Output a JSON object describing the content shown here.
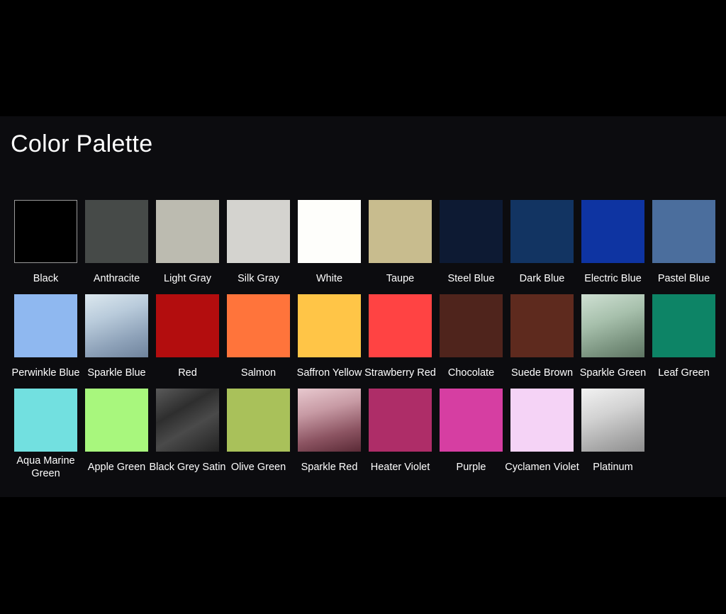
{
  "title": "Color Palette",
  "swatches": [
    {
      "label": "Black",
      "color": "#000000",
      "bg": "#000000",
      "border": "#9a9a9a"
    },
    {
      "label": "Anthracite",
      "color": "#464a48",
      "bg": "#464a48"
    },
    {
      "label": "Light Gray",
      "color": "#bcbbb0",
      "bg": "#bcbbb0"
    },
    {
      "label": "Silk Gray",
      "color": "#d4d3cf",
      "bg": "#d4d3cf"
    },
    {
      "label": "White",
      "color": "#fefefb",
      "bg": "#fefefb"
    },
    {
      "label": "Taupe",
      "color": "#c8bc8e",
      "bg": "#c8bc8e"
    },
    {
      "label": "Steel Blue",
      "color": "#0d1a33",
      "bg": "#0d1a33"
    },
    {
      "label": "Dark Blue",
      "color": "#123462",
      "bg": "#123462"
    },
    {
      "label": "Electric Blue",
      "color": "#0e34a2",
      "bg": "#0e34a2"
    },
    {
      "label": "Pastel Blue",
      "color": "#4b6e9d",
      "bg": "#4b6e9d"
    },
    {
      "label": "Perwinkle Blue",
      "color": "#8fb8f0",
      "bg": "#8fb8f0"
    },
    {
      "label": "Sparkle Blue",
      "color": "#b8cbdc",
      "bg": "linear-gradient(160deg, #dce8ef 0%, #b9cbdb 35%, #8ea2b9 70%, #6f839c 100%)"
    },
    {
      "label": "Red",
      "color": "#b30d0e",
      "bg": "#b30d0e"
    },
    {
      "label": "Salmon",
      "color": "#ff743b",
      "bg": "#ff743b"
    },
    {
      "label": "Saffron Yellow",
      "color": "#ffc547",
      "bg": "#ffc547"
    },
    {
      "label": "Strawberry Red",
      "color": "#ff4343",
      "bg": "#ff4343"
    },
    {
      "label": "Chocolate",
      "color": "#4f241c",
      "bg": "#4f241c"
    },
    {
      "label": "Suede Brown",
      "color": "#5e2a1e",
      "bg": "#5e2a1e"
    },
    {
      "label": "Sparkle Green",
      "color": "#9cb5a1",
      "bg": "linear-gradient(160deg, #cfe0d3 0%, #a7c0ac 40%, #7a937f 75%, #5e7563 100%)"
    },
    {
      "label": "Leaf Green",
      "color": "#0d8466",
      "bg": "#0d8466"
    },
    {
      "label": "Aqua Marine Green",
      "color": "#72e0e0",
      "bg": "#72e0e0"
    },
    {
      "label": "Apple Green",
      "color": "#a8f77d",
      "bg": "#a8f77d"
    },
    {
      "label": "Black Grey Satin",
      "color": "#3a3a3a",
      "bg": "linear-gradient(150deg, #5a5a5a 0%, #2e2e2e 35%, #4a4a4a 60%, #222222 100%)"
    },
    {
      "label": "Olive Green",
      "color": "#a9c15a",
      "bg": "#a9c15a"
    },
    {
      "label": "Sparkle Red",
      "color": "#b48790",
      "bg": "linear-gradient(165deg, #e8c9cf 0%, #c79aa4 35%, #8c5462 70%, #5a2a36 100%)"
    },
    {
      "label": "Heater Violet",
      "color": "#ae2d68",
      "bg": "#ae2d68"
    },
    {
      "label": "Purple",
      "color": "#d63ea2",
      "bg": "#d63ea2"
    },
    {
      "label": "Cyclamen Violet",
      "color": "#f5d3f6",
      "bg": "#f5d3f6"
    },
    {
      "label": "Platinum",
      "color": "#c6c6c6",
      "bg": "linear-gradient(160deg, #f2f2f2 0%, #d2d2d2 40%, #a9a9a9 75%, #8e8e8e 100%)"
    }
  ]
}
